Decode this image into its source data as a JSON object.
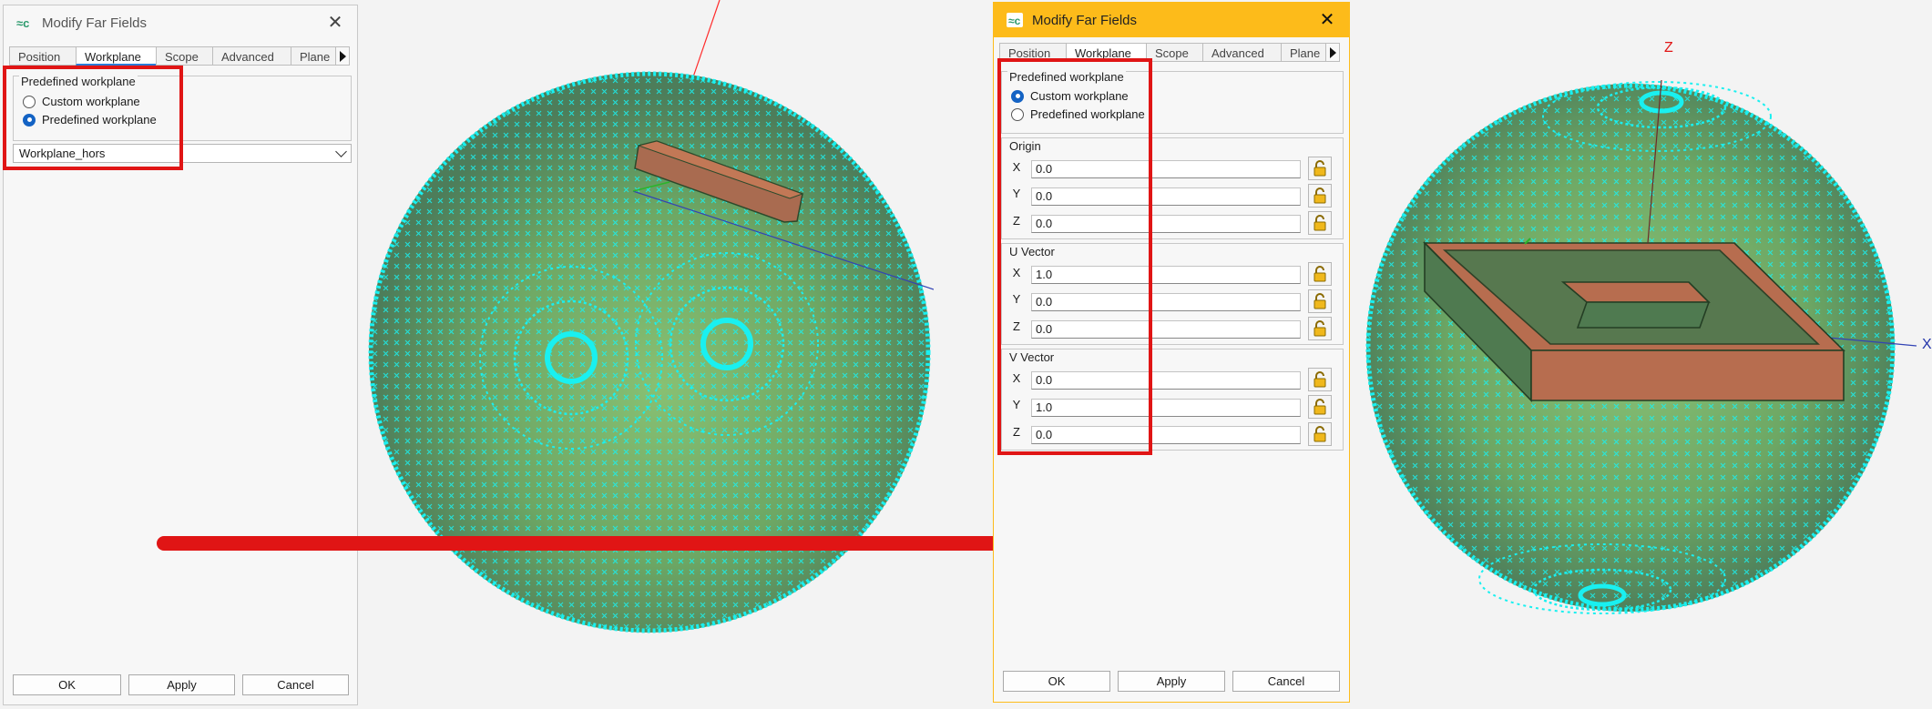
{
  "left_dialog": {
    "title": "Modify Far Fields",
    "tabs": [
      "Position",
      "Workplane",
      "Scope",
      "Advanced",
      "Plane"
    ],
    "active_tab": "Workplane",
    "group_title": "Predefined workplane",
    "radio_custom": "Custom workplane",
    "radio_predefined": "Predefined workplane",
    "selected_radio": "Predefined workplane",
    "workplane_value": "Workplane_hors",
    "ok": "OK",
    "apply": "Apply",
    "cancel": "Cancel"
  },
  "right_dialog": {
    "title": "Modify Far Fields",
    "tabs": [
      "Position",
      "Workplane",
      "Scope",
      "Advanced",
      "Plane"
    ],
    "active_tab": "Workplane",
    "group_title": "Predefined workplane",
    "radio_custom": "Custom workplane",
    "radio_predefined": "Predefined workplane",
    "selected_radio": "Custom workplane",
    "origin": {
      "label": "Origin",
      "x_label": "X",
      "y_label": "Y",
      "z_label": "Z",
      "x": "0.0",
      "y": "0.0",
      "z": "0.0"
    },
    "u_vector": {
      "label": "U Vector",
      "x_label": "X",
      "y_label": "Y",
      "z_label": "Z",
      "x": "1.0",
      "y": "0.0",
      "z": "0.0"
    },
    "v_vector": {
      "label": "V Vector",
      "x_label": "X",
      "y_label": "Y",
      "z_label": "Z",
      "x": "0.0",
      "y": "1.0",
      "z": "0.0"
    },
    "ok": "OK",
    "apply": "Apply",
    "cancel": "Cancel"
  },
  "viewport_right": {
    "axis_z": "Z",
    "axis_x": "X"
  },
  "colors": {
    "highlight": "#e01515",
    "right_titlebar": "#fdbb1a",
    "mesh_point": "#19f0f0",
    "sphere_fill": "#76b26a",
    "box_fill": "#b76d4f",
    "tab_accent": "#2b7bd8"
  },
  "icons": [
    "app-icon",
    "close-icon",
    "tab-scroll-arrow-icon",
    "chevron-down-icon",
    "lock-icon",
    "arrow-right-icon"
  ]
}
